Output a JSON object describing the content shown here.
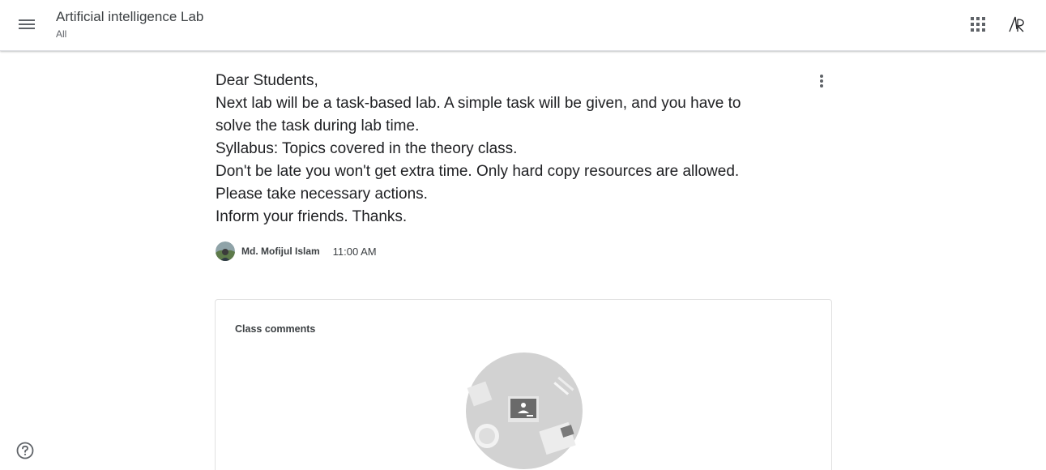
{
  "header": {
    "class_title": "Artificial intelligence Lab",
    "section": "All",
    "menu_icon": "hamburger-menu-icon",
    "apps_icon": "google-apps-grid-icon",
    "account_icon": "account-avatar-icon"
  },
  "announcement": {
    "body": "Dear Students,\nNext lab will be a task-based lab. A simple task will be given, and you have to\nsolve the task during lab time.\nSyllabus: Topics covered in the theory class.\nDon't be late you won't get extra time. Only hard copy resources are allowed.\nPlease take necessary actions.\nInform your friends. Thanks.",
    "more_icon": "more-vert-icon",
    "author": {
      "name": "Md. Mofijul Islam",
      "time": "11:00 AM"
    }
  },
  "comments": {
    "title": "Class comments",
    "illustration": "empty-classroom-illustration"
  },
  "footer": {
    "help_icon": "help-icon"
  }
}
